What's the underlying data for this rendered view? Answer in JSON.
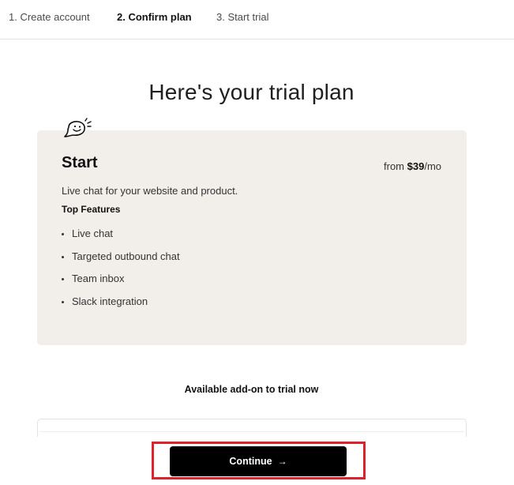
{
  "steps": [
    {
      "label": "1. Create account"
    },
    {
      "label": "2. Confirm plan"
    },
    {
      "label": "3. Start trial"
    }
  ],
  "page_title": "Here's your trial plan",
  "plan": {
    "icon": "smiley-chat-bubble-icon",
    "name": "Start",
    "price_prefix": "from",
    "price_amount": "$39",
    "price_suffix": "/mo",
    "description": "Live chat for your website and product.",
    "features_heading": "Top Features",
    "features": [
      "Live chat",
      "Targeted outbound chat",
      "Team inbox",
      "Slack integration"
    ]
  },
  "addon": {
    "heading": "Available add-on to trial now"
  },
  "footer": {
    "continue_label": "Continue",
    "continue_icon": "arrow-right-icon",
    "continue_arrow": "→",
    "highlight_color": "#e0202a"
  },
  "colors": {
    "card_background": "#f2efea",
    "button_background": "#000000"
  }
}
